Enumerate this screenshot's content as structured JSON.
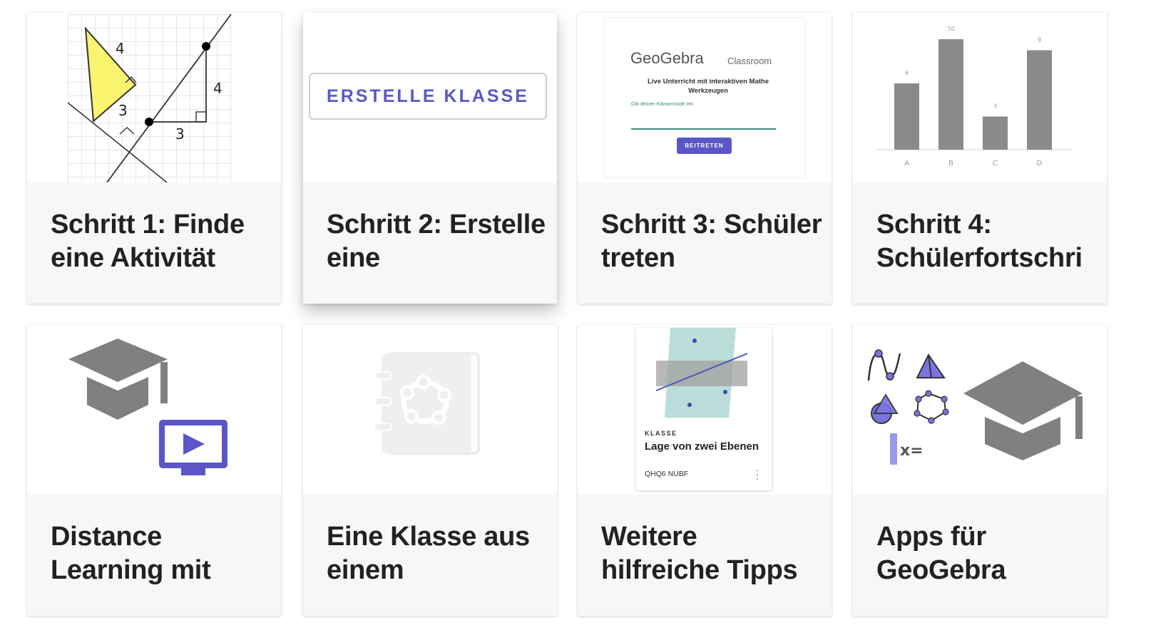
{
  "cards": [
    {
      "title": "Schritt 1: Finde eine Aktivität",
      "thumbnail": "triangle-geometry-diagram",
      "figure_labels": {
        "leg_top": "4",
        "leg_left": "3",
        "rise": "4",
        "run": "3"
      }
    },
    {
      "title": "Schritt 2: Erstelle eine",
      "thumbnail": "create-class-button",
      "button_label": "ERSTELLE KLASSE"
    },
    {
      "title": "Schritt 3: Schüler treten",
      "thumbnail": "geogebra-classroom-join",
      "logo": "GeoGebra",
      "product": "Classroom",
      "description": "Live Unterricht mit interaktiven Mathe Werkzeugen",
      "code_hint": "Gib deinen Klassencode ein",
      "join_label": "BEITRETEN"
    },
    {
      "title": "Schritt 4: Schülerfortschri",
      "thumbnail": "bar-chart"
    },
    {
      "title": "Distance Learning mit",
      "thumbnail": "graduation-cap-and-video-icon"
    },
    {
      "title": "Eine Klasse aus einem",
      "thumbnail": "notebook-icon"
    },
    {
      "title": "Weitere hilfreiche Tipps",
      "thumbnail": "class-card-preview",
      "class_label": "KLASSE",
      "class_name": "Lage von zwei Ebenen",
      "class_code": "QHQ6 NUBF"
    },
    {
      "title": "Apps für GeoGebra",
      "thumbnail": "geogebra-app-icons-and-cap",
      "cas_label": "x="
    }
  ],
  "chart_data": {
    "type": "bar",
    "categories": [
      "A",
      "B",
      "C",
      "D"
    ],
    "values": [
      6,
      10,
      3,
      9
    ],
    "bar_color": "#8a8a8a",
    "ylim": [
      0,
      10
    ],
    "grid": false
  },
  "colors": {
    "accent": "#5b57c8",
    "card_bg": "#f7f7f7",
    "icon_gray": "#808080",
    "teal": "#3b8a7d"
  }
}
